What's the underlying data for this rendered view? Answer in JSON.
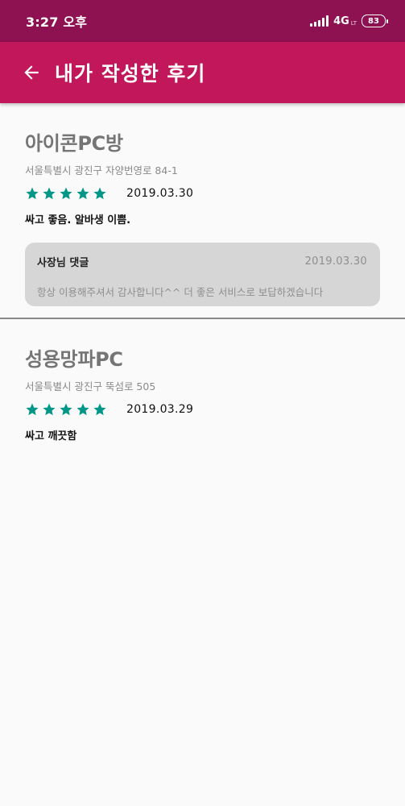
{
  "status_bar": {
    "time": "3:27 오후",
    "network": "4G",
    "network_sub": "LT",
    "battery": "83"
  },
  "app_bar": {
    "title": "내가 작성한 후기",
    "back_icon": "arrow-left-icon",
    "color": "#c2185b"
  },
  "colors": {
    "status_bar": "#8e1152",
    "star": "#009688",
    "reply_bg": "#d6d6d6",
    "background": "#fafafa"
  },
  "reviews": [
    {
      "store_name": "아이콘PC방",
      "address": "서울특별시 광진구 자양번영로 84-1",
      "rating": 5,
      "date": "2019.03.30",
      "text": "싸고 좋음. 알바생 이쁨.",
      "owner_reply": {
        "label": "사장님 댓글",
        "date": "2019.03.30",
        "text": "항상 이용해주셔서 감사합니다^^ 더 좋은 서비스로 보답하겠습니다"
      }
    },
    {
      "store_name": "성용망파PC",
      "address": "서울특별시 광진구 뚝섬로 505",
      "rating": 5,
      "date": "2019.03.29",
      "text": "싸고 깨끗함"
    }
  ]
}
